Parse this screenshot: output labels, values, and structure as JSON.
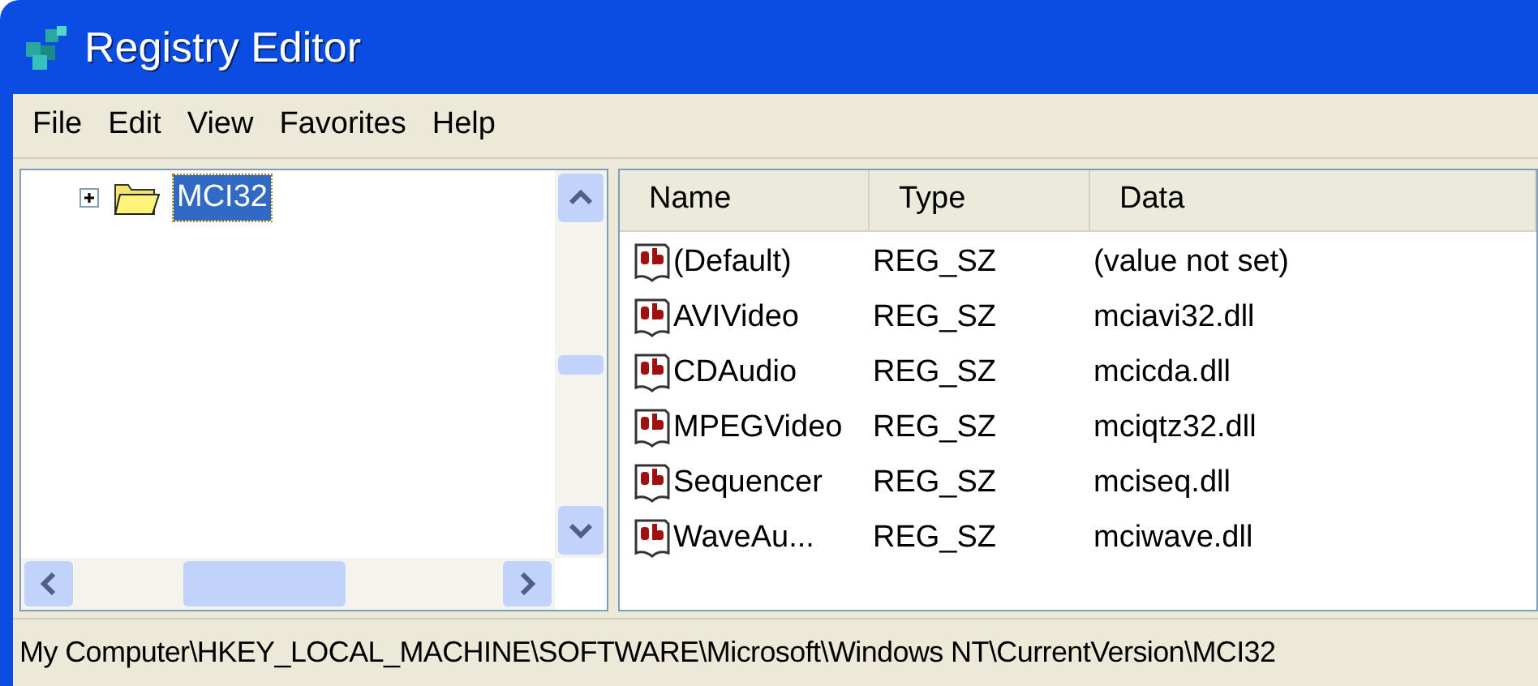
{
  "window": {
    "title": "Registry Editor"
  },
  "menu": [
    "File",
    "Edit",
    "View",
    "Favorites",
    "Help"
  ],
  "tree": [
    {
      "label": "MCI32",
      "selected": true,
      "expanded": false
    }
  ],
  "table": {
    "columns": [
      "Name",
      "Type",
      "Data"
    ],
    "rows": [
      {
        "name": "(Default)",
        "type": "REG_SZ",
        "data": "(value not set)"
      },
      {
        "name": "AVIVideo",
        "type": "REG_SZ",
        "data": "mciavi32.dll"
      },
      {
        "name": "CDAudio",
        "type": "REG_SZ",
        "data": "mcicda.dll"
      },
      {
        "name": "MPEGVideo",
        "type": "REG_SZ",
        "data": "mciqtz32.dll"
      },
      {
        "name": "Sequencer",
        "type": "REG_SZ",
        "data": "mciseq.dll"
      },
      {
        "name": "WaveAu...",
        "type": "REG_SZ",
        "data": "mciwave.dll"
      }
    ]
  },
  "status_bar": "My Computer\\HKEY_LOCAL_MACHINE\\SOFTWARE\\Microsoft\\Windows NT\\CurrentVersion\\MCI32"
}
